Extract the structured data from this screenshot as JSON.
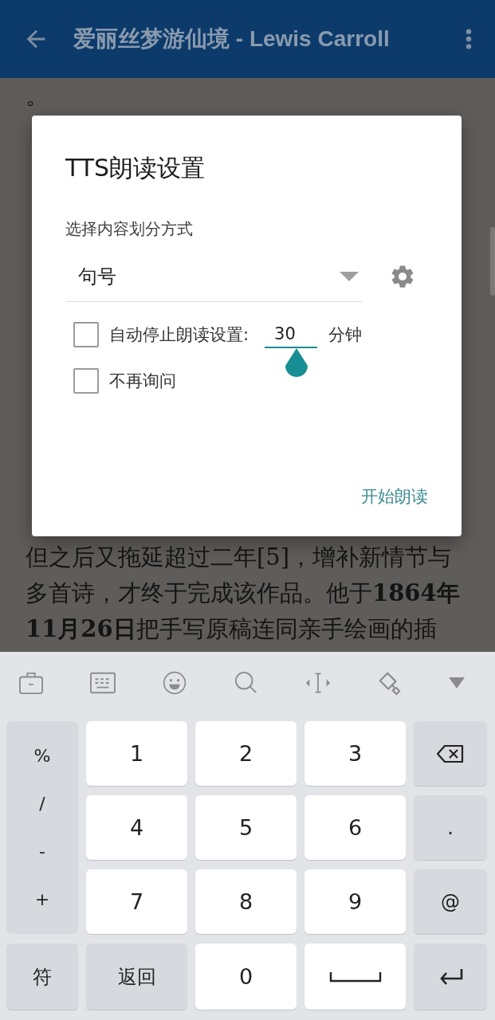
{
  "app_bar": {
    "title": "爱丽丝梦游仙境 - Lewis Carroll"
  },
  "reader": {
    "lines_above_dialog": [
      "。"
    ],
    "lines_below_dialog": [
      "但之后又拖延超过二年[5]，增补新情节与",
      "多首诗，才终于完成该作品。他于**1864年**",
      "**11月26日**把手写原稿连同亲手绘画的插"
    ]
  },
  "dialog": {
    "title": "TTS朗读设置",
    "split_label": "选择内容划分方式",
    "split_value": "句号",
    "auto_stop": {
      "checked": false,
      "label": "自动停止朗读设置:",
      "minutes": "30",
      "focused": true,
      "unit": "分钟"
    },
    "dont_ask": {
      "checked": false,
      "label": "不再询问"
    },
    "action": "开始朗读"
  },
  "keyboard": {
    "symbol_column": [
      "%",
      "/",
      "-",
      "+"
    ],
    "digit_rows": [
      [
        "1",
        "2",
        "3"
      ],
      [
        "4",
        "5",
        "6"
      ],
      [
        "7",
        "8",
        "9"
      ]
    ],
    "right_column": [
      {
        "kind": "backspace"
      },
      {
        "kind": "function",
        "label": "."
      },
      {
        "kind": "function",
        "label": "@"
      }
    ],
    "bottom_row": [
      {
        "kind": "function",
        "label": "符"
      },
      {
        "kind": "function",
        "label": "返回"
      },
      {
        "kind": "digit",
        "label": "0"
      },
      {
        "kind": "space"
      },
      {
        "kind": "enter"
      }
    ]
  }
}
